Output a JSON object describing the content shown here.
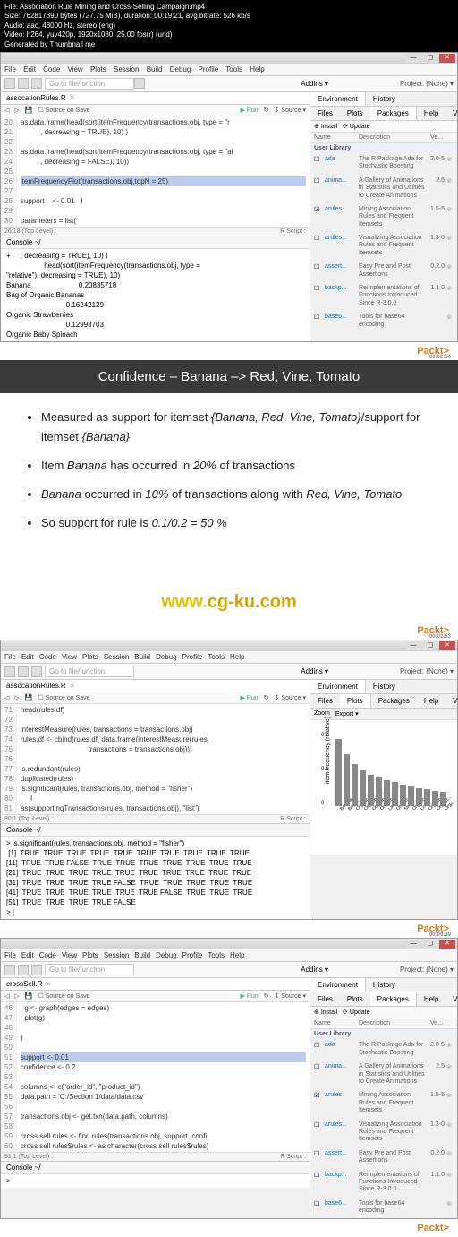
{
  "video_info": {
    "file": "File: Association Rule Mining and Cross-Selling Campaign.mp4",
    "size": "Size: 762817390 bytes (727.75 MiB), duration: 00:19:21, avg.bitrate: 526 kb/s",
    "audio": "Audio: aac, 48000 Hz, stereo (eng)",
    "video": "Video: h264, yuv420p, 1920x1080, 25.00 fps(r) (und)",
    "gen": "Generated by Thumbnail me"
  },
  "menu": [
    "File",
    "Edit",
    "Code",
    "View",
    "Plots",
    "Session",
    "Build",
    "Debug",
    "Profile",
    "Tools",
    "Help"
  ],
  "toolbar": {
    "search_placeholder": "Go to file/function",
    "addins": "Addins ▾",
    "project": "Project: (None) ▾"
  },
  "ide1": {
    "filename": "assocationRules.R",
    "editor_toolbar": {
      "source_on_save": "Source on Save",
      "run": "Run",
      "source": "Source"
    },
    "lines": [
      {
        "n": "20",
        "t": "as.data.frame(head(sort(itemFrequency(transactions.obj, type = \"r"
      },
      {
        "n": "21",
        "t": "          , decreasing = TRUE), 10) )"
      },
      {
        "n": "22",
        "t": ""
      },
      {
        "n": "23",
        "t": "as.data.frame(head(sort(itemFrequency(transactions.obj, type = \"al"
      },
      {
        "n": "24",
        "t": "          , decreasing = FALSE), 10))"
      },
      {
        "n": "25",
        "t": ""
      },
      {
        "n": "26",
        "t": "itemFrequencyPlot(transactions.obj,topN = 25)",
        "hl": true
      },
      {
        "n": "27",
        "t": ""
      },
      {
        "n": "28",
        "t": "support    <- 0.01   I"
      },
      {
        "n": "29",
        "t": ""
      },
      {
        "n": "30",
        "t": "parameters = list("
      }
    ],
    "status_left": "26:18   (Top Level) :",
    "status_right": "R Script :",
    "console_title": "Console ~/",
    "console": [
      "+     , decreasing = TRUE), 10) )",
      "                   head(sort(itemFrequency(transactions.obj, type =",
      "\"relative\"), decreasing = TRUE), 10)",
      "Banana                        0.20835718",
      "Bag of Organic Bananas",
      "                              0.16242129",
      "Organic Strawberries",
      "                              0.12993703",
      "Organic Baby Spinach"
    ]
  },
  "env_tabs": {
    "env": "Environment",
    "hist": "History"
  },
  "files_tabs": [
    "Files",
    "Plots",
    "Packages",
    "Help",
    "Viewer"
  ],
  "pkg_toolbar": {
    "install": "Install",
    "update": "Update"
  },
  "pkg_header": {
    "name": "Name",
    "desc": "Description",
    "ver": "Ve..."
  },
  "pkg_section": "User Library",
  "packages": [
    {
      "chk": false,
      "name": "ada",
      "desc": "The R Package Ada for Stochastic Boosting",
      "ver": "2.0-5"
    },
    {
      "chk": false,
      "name": "anima...",
      "desc": "A Gallery of Animations in Statistics and Utilities to Create Animations",
      "ver": "2.5"
    },
    {
      "chk": true,
      "name": "arules",
      "desc": "Mining Association Rules and Frequent Itemsets",
      "ver": "1.5-5"
    },
    {
      "chk": false,
      "name": "arules...",
      "desc": "Visualizing Association Rules and Frequent Itemsets",
      "ver": "1.3-0"
    },
    {
      "chk": false,
      "name": "assert...",
      "desc": "Easy Pre and Post Assertions",
      "ver": "0.2.0"
    },
    {
      "chk": false,
      "name": "backp...",
      "desc": "Reimplementations of Functions Introduced Since R-3.0.0",
      "ver": "1.1.0"
    },
    {
      "chk": false,
      "name": "base6...",
      "desc": "Tools for base64 encoding",
      "ver": ""
    }
  ],
  "banner": "Confidence – Banana –> Red, Vine, Tomato",
  "slide": [
    "Measured as support for itemset {Banana, Red, Vine, Tomato}/support for itemset {Banana}",
    "Item Banana has occurred in 20% of transactions",
    "Banana occurred in 10% of transactions along with Red, Vine, Tomato",
    "So support for rule is 0.1/0.2 = 50 %"
  ],
  "watermark_1": "www.",
  "watermark_2": "cg-ku.com",
  "packt": "Packt>",
  "timestamps": [
    "00:02:54",
    "00:02:53",
    "00:09:39"
  ],
  "ide2": {
    "filename": "assocationRules.R",
    "lines": [
      {
        "n": "71",
        "t": "head(rules.df)"
      },
      {
        "n": "72",
        "t": ""
      },
      {
        "n": "73",
        "t": "interestMeasure(rules, transactions = transactions.obj)"
      },
      {
        "n": "74",
        "t": "rules.df <- cbind(rules.df, data.frame(interestMeasure(rules,"
      },
      {
        "n": "75",
        "t": "                                  transactions = transactions.obj)))"
      },
      {
        "n": "76",
        "t": ""
      },
      {
        "n": "77",
        "t": "is.redundant(rules)"
      },
      {
        "n": "78",
        "t": "duplicated(rules)"
      },
      {
        "n": "79",
        "t": "is.significant(rules, transactions.obj, method = \"fisher\")"
      },
      {
        "n": "80",
        "t": "     I"
      },
      {
        "n": "81",
        "t": "as(supportingTransactions(rules, transactions.obj), \"list\")"
      }
    ],
    "status_left": "80:1   (Top Level) :",
    "status_right": "R Script :",
    "console_title": "Console ~/",
    "console": [
      "> is.significant(rules, transactions.obj, method = \"fisher\")",
      " [1]  TRUE  TRUE  TRUE  TRUE  TRUE  TRUE  TRUE  TRUE  TRUE  TRUE",
      "[11]  TRUE  TRUE FALSE  TRUE  TRUE  TRUE  TRUE  TRUE  TRUE  TRUE",
      "[21]  TRUE  TRUE  TRUE  TRUE  TRUE  TRUE  TRUE  TRUE  TRUE  TRUE",
      "[31]  TRUE  TRUE  TRUE  TRUE FALSE  TRUE  TRUE  TRUE  TRUE  TRUE",
      "[41]  TRUE  TRUE  TRUE  TRUE  TRUE  TRUE FALSE  TRUE  TRUE  TRUE",
      "[51]  TRUE  TRUE  TRUE  TRUE FALSE",
      "> |"
    ]
  },
  "plot_toolbar": [
    "Zoom",
    "Export ▾"
  ],
  "chart_data": {
    "type": "bar",
    "ylabel": "item frequency (relative)",
    "yticks": [
      0.0,
      0.1,
      0.2
    ],
    "categories": [
      "Banana",
      "Bag of...",
      "Organic St...",
      "Organic Ba...",
      "Organic...",
      "Organic...",
      "Large...",
      "Organic...",
      "Straw...",
      "Organic...",
      "Limes",
      "Organic...",
      "Organic...",
      "Orga..."
    ],
    "values": [
      0.208,
      0.162,
      0.13,
      0.11,
      0.098,
      0.09,
      0.082,
      0.075,
      0.068,
      0.062,
      0.057,
      0.053,
      0.049,
      0.046
    ]
  },
  "ide3": {
    "filename": "crossSell.R",
    "lines": [
      {
        "n": "46",
        "t": "  g <- graph(edges = edges)"
      },
      {
        "n": "47",
        "t": "  plot(g)"
      },
      {
        "n": "48",
        "t": ""
      },
      {
        "n": "49",
        "t": "}"
      },
      {
        "n": "50",
        "t": ""
      },
      {
        "n": "51",
        "t": "support <- 0.01",
        "hl": true
      },
      {
        "n": "52",
        "t": "confidence <- 0.2"
      },
      {
        "n": "53",
        "t": ""
      },
      {
        "n": "54",
        "t": "columns <- c(\"order_id\", \"product_id\")"
      },
      {
        "n": "55",
        "t": "data.path = 'C:/Section 1/data/data.csv'"
      },
      {
        "n": "56",
        "t": ""
      },
      {
        "n": "57",
        "t": "transactions.obj <- get.txn(data.path, columns)"
      },
      {
        "n": "58",
        "t": ""
      },
      {
        "n": "59",
        "t": "cross.sell.rules <- find.rules(transactions.obj, support, confi"
      },
      {
        "n": "60",
        "t": "cross sell rules$rules <- as character(cross sell rules$rules)"
      }
    ],
    "status_left": "51:1   (Top Level) :",
    "status_right": "R Script :",
    "console_title": "Console ~/",
    "console": [
      "> "
    ]
  }
}
